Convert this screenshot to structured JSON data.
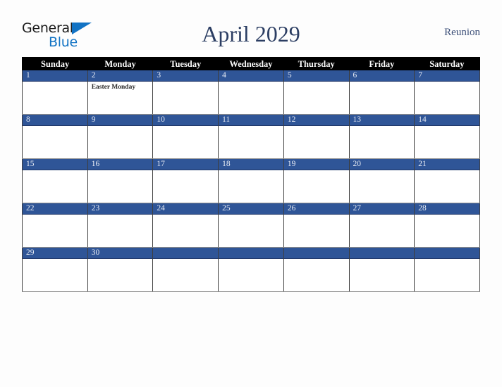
{
  "header": {
    "logo": {
      "word1": "General",
      "word2": "Blue",
      "triangle_icon": "triangle-icon",
      "color1": "#1a1a1a",
      "color2": "#1273c4"
    },
    "title": "April 2029",
    "country": "Reunion"
  },
  "calendar": {
    "weekday_headers": [
      "Sunday",
      "Monday",
      "Tuesday",
      "Wednesday",
      "Thursday",
      "Friday",
      "Saturday"
    ],
    "header_bg": "#000000",
    "daynum_bg": "#2f5597",
    "weeks": [
      [
        {
          "day": "1",
          "events": []
        },
        {
          "day": "2",
          "events": [
            "Easter Monday"
          ]
        },
        {
          "day": "3",
          "events": []
        },
        {
          "day": "4",
          "events": []
        },
        {
          "day": "5",
          "events": []
        },
        {
          "day": "6",
          "events": []
        },
        {
          "day": "7",
          "events": []
        }
      ],
      [
        {
          "day": "8",
          "events": []
        },
        {
          "day": "9",
          "events": []
        },
        {
          "day": "10",
          "events": []
        },
        {
          "day": "11",
          "events": []
        },
        {
          "day": "12",
          "events": []
        },
        {
          "day": "13",
          "events": []
        },
        {
          "day": "14",
          "events": []
        }
      ],
      [
        {
          "day": "15",
          "events": []
        },
        {
          "day": "16",
          "events": []
        },
        {
          "day": "17",
          "events": []
        },
        {
          "day": "18",
          "events": []
        },
        {
          "day": "19",
          "events": []
        },
        {
          "day": "20",
          "events": []
        },
        {
          "day": "21",
          "events": []
        }
      ],
      [
        {
          "day": "22",
          "events": []
        },
        {
          "day": "23",
          "events": []
        },
        {
          "day": "24",
          "events": []
        },
        {
          "day": "25",
          "events": []
        },
        {
          "day": "26",
          "events": []
        },
        {
          "day": "27",
          "events": []
        },
        {
          "day": "28",
          "events": []
        }
      ],
      [
        {
          "day": "29",
          "events": []
        },
        {
          "day": "30",
          "events": []
        },
        {
          "day": "",
          "events": []
        },
        {
          "day": "",
          "events": []
        },
        {
          "day": "",
          "events": []
        },
        {
          "day": "",
          "events": []
        },
        {
          "day": "",
          "events": []
        }
      ]
    ]
  }
}
